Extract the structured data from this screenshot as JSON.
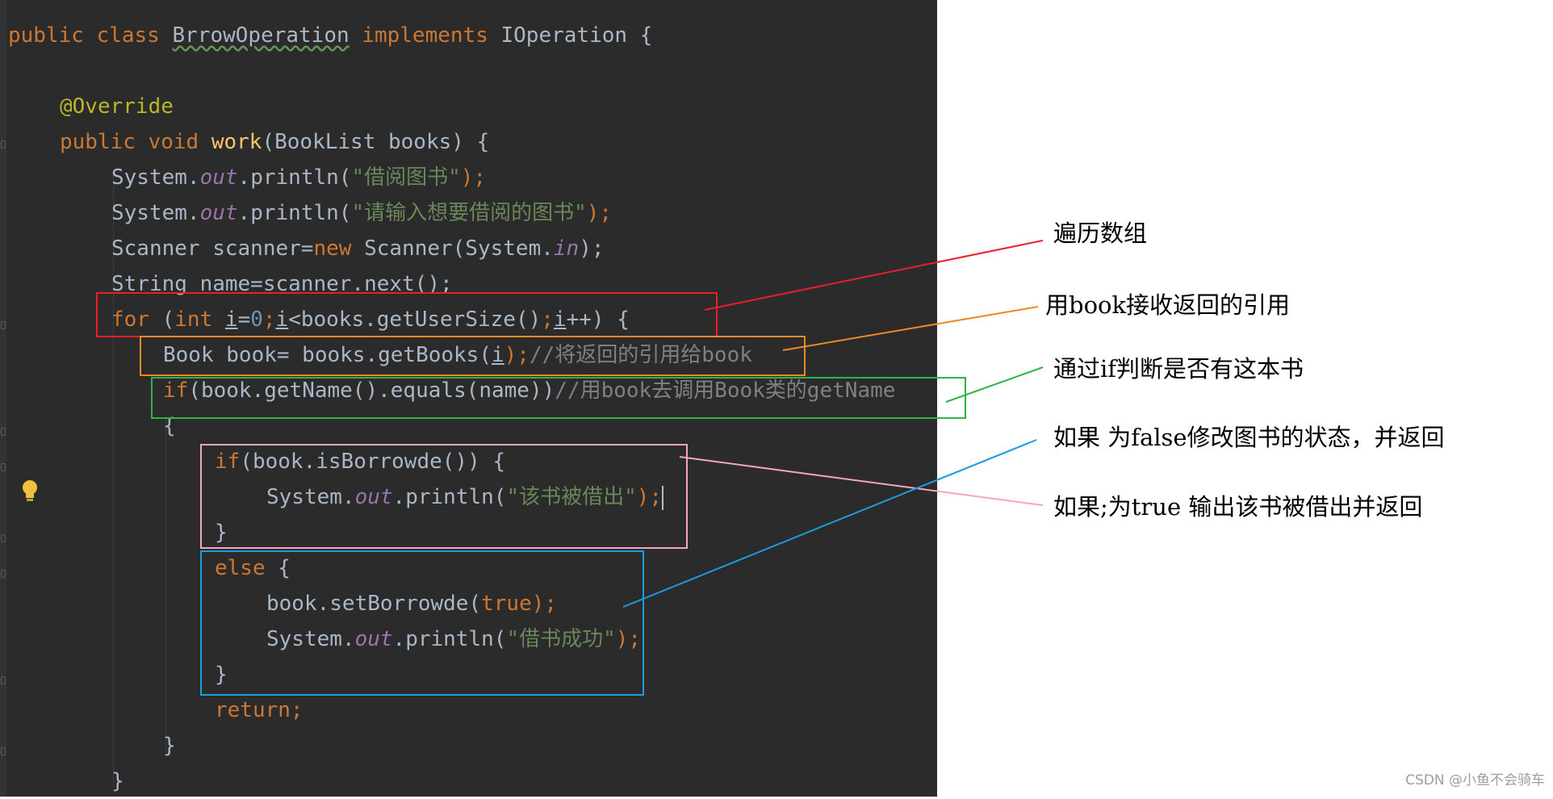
{
  "code": {
    "l1": {
      "kw1": "public class ",
      "cls": "BrrowOperation",
      "kw2": " implements ",
      "iface": "IOperation",
      "tail": " {"
    },
    "l2": {
      "ann": "@Override"
    },
    "l3": {
      "kw": "public void ",
      "fn": "work",
      "args": "(BookList books) {"
    },
    "l4": {
      "a": "System.",
      "out": "out",
      "b": ".println(",
      "str": "\"借阅图书\"",
      "c": ");"
    },
    "l5": {
      "a": "System.",
      "out": "out",
      "b": ".println(",
      "str": "\"请输入想要借阅的图书\"",
      "c": ");"
    },
    "l6": {
      "a": "Scanner scanner=",
      "kw": "new",
      "b": " Scanner(System.",
      "in": "in",
      "c": ");"
    },
    "l7": {
      "a": "String name=scanner.next();"
    },
    "l8": {
      "kw1": "for",
      "a": " (",
      "kw2": "int ",
      "i1": "i",
      "eq": "=",
      "zero": "0",
      "semi1": ";",
      "i2": "i",
      "cond": "<books.getUserSize()",
      "semi2": ";",
      "i3": "i",
      "inc": "++) {"
    },
    "l9": {
      "a": "Book book= books.getBooks(",
      "i": "i",
      "b": ");",
      "cm": "//将返回的引用给book"
    },
    "l10": {
      "kw": "if",
      "a": "(book.getName().equals(name))",
      "cm": "//用book去调用Book类的getName"
    },
    "l11": {
      "a": "{"
    },
    "l12": {
      "kw": "if",
      "a": "(book.isBorrowde()) {"
    },
    "l13": {
      "a": "System.",
      "out": "out",
      "b": ".println(",
      "str": "\"该书被借出\"",
      "c": ");"
    },
    "l14": {
      "a": "}"
    },
    "l15": {
      "kw": "else",
      "a": " {"
    },
    "l16": {
      "a": "book.setBorrowde(",
      "kw": "true",
      "b": ");"
    },
    "l17": {
      "a": "System.",
      "out": "out",
      "b": ".println(",
      "str": "\"借书成功\"",
      "c": ");"
    },
    "l18": {
      "a": "}"
    },
    "l19": {
      "kw": "return",
      "a": ";"
    },
    "l20": {
      "a": "}"
    },
    "l21": {
      "a": "}"
    }
  },
  "annotations": {
    "traverse": "遍历数组",
    "receive": "用book接收返回的引用",
    "check": "通过if判断是否有这本书",
    "if_false": "如果 为false修改图书的状态，并返回",
    "if_true": "如果;为true 输出该书被借出并返回"
  },
  "watermark": "CSDN @小鱼不会骑车",
  "colors": {
    "red": "#e8202a",
    "orange": "#f08a24",
    "green": "#2fb34a",
    "pink": "#f4a6c0",
    "blue": "#1a9ee0"
  }
}
